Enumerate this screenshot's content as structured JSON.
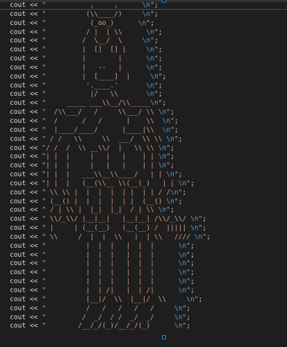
{
  "lines": [
    {
      "kw": "cout",
      "op": " << ",
      "q1": "\"",
      "art": "           ,     ,      ",
      "esc": "\\n",
      "q2": "\"",
      "end": ";"
    },
    {
      "kw": "cout",
      "op": " << ",
      "q1": "\"",
      "art": "          (\\\\____/)     ",
      "esc": "\\n",
      "q2": "\"",
      "end": ";"
    },
    {
      "kw": "cout",
      "op": " << ",
      "q1": "\"",
      "art": "           (_oo_)      ",
      "esc": "\\n",
      "q2": "\"",
      "end": ";"
    },
    {
      "kw": "cout",
      "op": " << ",
      "q1": "\"",
      "art": "          / |  | \\\\      ",
      "esc": "\\n",
      "q2": "\"",
      "end": ";"
    },
    {
      "kw": "cout",
      "op": " << ",
      "q1": "\"",
      "art": "         /  \\__/  \\     ",
      "esc": "\\n",
      "q2": "\"",
      "end": ";"
    },
    {
      "kw": "cout",
      "op": " << ",
      "q1": "\"",
      "art": "         |  []  [] |     ",
      "esc": "\\n",
      "q2": "\"",
      "end": ";"
    },
    {
      "kw": "cout",
      "op": " << ",
      "q1": "\"",
      "art": "         |        |      ",
      "esc": "\\n",
      "q2": "\"",
      "end": ";"
    },
    {
      "kw": "cout",
      "op": " << ",
      "q1": "\"",
      "art": "         |   --   |      ",
      "esc": "\\n",
      "q2": "\"",
      "end": ";"
    },
    {
      "kw": "cout",
      "op": " << ",
      "q1": "\"",
      "art": "         |  [____]  |     ",
      "esc": "\\n",
      "q2": "\"",
      "end": ";"
    },
    {
      "kw": "cout",
      "op": " << ",
      "q1": "\"",
      "art": "          '.____.'       ",
      "esc": "\\n",
      "q2": "\"",
      "end": ";"
    },
    {
      "kw": "cout",
      "op": " << ",
      "q1": "\"",
      "art": "           |/   \\\\       ",
      "esc": "\\n",
      "q2": "\"",
      "end": ";"
    },
    {
      "kw": "cout",
      "op": " << ",
      "q1": "\"",
      "art": "     _____ ___\\\\__/\\\\_____",
      "esc": "\\n",
      "q2": "\"",
      "end": ";"
    },
    {
      "kw": "cout",
      "op": " << ",
      "q1": "\"",
      "art": "  /\\\\___/   /     \\\\___/ \\\\ ",
      "esc": "\\n",
      "q2": "\"",
      "end": ";"
    },
    {
      "kw": "cout",
      "op": " << ",
      "q1": "\"",
      "art": "  /      /   /      |    \\\\  ",
      "esc": "\\n",
      "q2": "\"",
      "end": ";"
    },
    {
      "kw": "cout",
      "op": " << ",
      "q1": "\"",
      "art": "  |____/____/      |____|\\\\  ",
      "esc": "\\n",
      "q2": "\"",
      "end": ";"
    },
    {
      "kw": "cout",
      "op": " << ",
      "q1": "\"",
      "art": " / /   \\\\     \\\\  ___/  \\\\ \\\\ ",
      "esc": "\\n",
      "q2": "\"",
      "end": ";"
    },
    {
      "kw": "cout",
      "op": " << ",
      "q1": "\"",
      "art": "/ /  /  \\\\ __\\\\/  |   \\\\ \\\\ ",
      "esc": "\\n",
      "q2": "\"",
      "end": ";"
    },
    {
      "kw": "cout",
      "op": " << ",
      "q1": "\"",
      "art": "| |  |     |   |   |    | | ",
      "esc": "\\n",
      "q2": "\"",
      "end": ";"
    },
    {
      "kw": "cout",
      "op": " << ",
      "q1": "\"",
      "art": "| |  |     |   |   |    | | ",
      "esc": "\\n",
      "q2": "\"",
      "end": ";"
    },
    {
      "kw": "cout",
      "op": " << ",
      "q1": "\"",
      "art": "| |  |   ___\\\\__\\\\____/   | | ",
      "esc": "\\n",
      "q2": "\"",
      "end": ";"
    },
    {
      "kw": "cout",
      "op": " << ",
      "q1": "\"",
      "art": "| |  |   (__(\\\\__ \\\\(__(_)   | | ",
      "esc": "\\n",
      "q2": "\"",
      "end": ";"
    },
    {
      "kw": "cout",
      "op": " << ",
      "q1": "\"",
      "art": " \\\\ \\\\ |  |  |  |  | |  | | / /",
      "esc": "\\n",
      "q2": "\"",
      "end": ";"
    },
    {
      "kw": "cout",
      "op": " << ",
      "q1": "\"",
      "art": " (__() |  |  |  |  | |  (__() ",
      "esc": "\\n",
      "q2": "\"",
      "end": ";"
    },
    {
      "kw": "cout",
      "op": " << ",
      "q1": "\"",
      "art": " / | \\\\ |  |_|  |_|  / | \\\\ ",
      "esc": "\\n",
      "q2": "\"",
      "end": ";"
    },
    {
      "kw": "cout",
      "op": " << ",
      "q1": "\"",
      "art": " \\\\/_\\\\/ |__|__|   |__|__| /\\\\/_\\\\/ ",
      "esc": "\\n",
      "q2": "\"",
      "end": ";"
    },
    {
      "kw": "cout",
      "op": " << ",
      "q1": "\"",
      "art": " |     | (__(__)   (__(__) /  ||||| ",
      "esc": "\\n",
      "q2": "\"",
      "end": ";"
    },
    {
      "kw": "cout",
      "op": " << ",
      "q1": "\"",
      "art": " \\\\     /  |  |  \\\\   |  | \\\\   //// ",
      "esc": "\\n",
      "q2": "\"",
      "end": ";"
    },
    {
      "kw": "cout",
      "op": " << ",
      "q1": "\"",
      "art": "          |  |  |   |  |  |      ",
      "esc": "\\n",
      "q2": "\"",
      "end": ";"
    },
    {
      "kw": "cout",
      "op": " << ",
      "q1": "\"",
      "art": "          |  |  |   |  |  |      ",
      "esc": "\\n",
      "q2": "\"",
      "end": ";"
    },
    {
      "kw": "cout",
      "op": " << ",
      "q1": "\"",
      "art": "          |  |  |   |  |  |      ",
      "esc": "\\n",
      "q2": "\"",
      "end": ";"
    },
    {
      "kw": "cout",
      "op": " << ",
      "q1": "\"",
      "art": "          |  |  |   |  |  |      ",
      "esc": "\\n",
      "q2": "\"",
      "end": ";"
    },
    {
      "kw": "cout",
      "op": " << ",
      "q1": "\"",
      "art": "          |  |  |   |  |  |      ",
      "esc": "\\n",
      "q2": "\"",
      "end": ";"
    },
    {
      "kw": "cout",
      "op": " << ",
      "q1": "\"",
      "art": "          |  | /|   |  | /|      ",
      "esc": "\\n",
      "q2": "\"",
      "end": ";"
    },
    {
      "kw": "cout",
      "op": " << ",
      "q1": "\"",
      "art": "          |__|/  \\\\  |__|/  \\\\     ",
      "esc": "\\n",
      "q2": "\"",
      "end": ";"
    },
    {
      "kw": "cout",
      "op": " << ",
      "q1": "\"",
      "art": "          /   /   /   /   /     ",
      "esc": "\\n",
      "q2": "\"",
      "end": ";"
    },
    {
      "kw": "cout",
      "op": " << ",
      "q1": "\"",
      "art": "         /  _/  / /  _/  _/     ",
      "esc": "\\n",
      "q2": "\"",
      "end": ";"
    },
    {
      "kw": "cout",
      "op": " << ",
      "q1": "\"",
      "art": "        /__/_/(_)/__/_/(_)      ",
      "esc": "\\n",
      "q2": "\"",
      "end": ";"
    }
  ],
  "colors": {
    "background": "#1e1e1e",
    "keyword": "#dcdcdc",
    "string": "#d69d85",
    "escape": "#569cd6",
    "current_line_rule": "#a33b2a",
    "selection_marker": "#2a80d8"
  }
}
